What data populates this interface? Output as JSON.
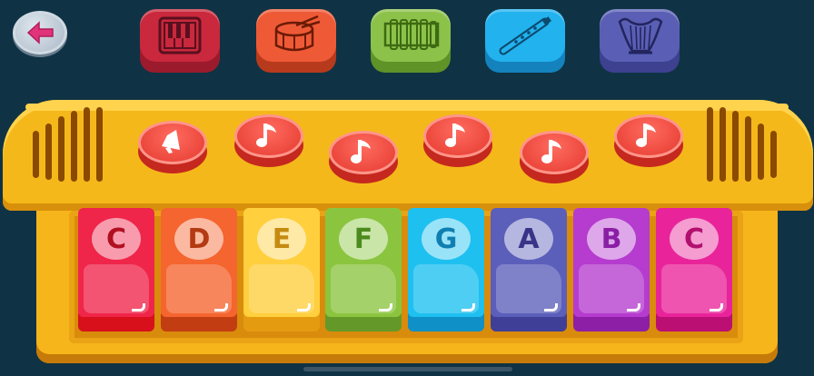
{
  "toolbar": {
    "back": {
      "icon": "back-arrow-icon"
    },
    "instruments": [
      {
        "name": "piano",
        "icon": "piano-icon",
        "face": "#c9283d",
        "base": "#9b1b2d"
      },
      {
        "name": "drum",
        "icon": "drum-icon",
        "face": "#ef5a36",
        "base": "#b83a1d"
      },
      {
        "name": "xylophone",
        "icon": "xylophone-icon",
        "face": "#8cc24a",
        "base": "#5f9227"
      },
      {
        "name": "flute",
        "icon": "flute-icon",
        "face": "#22b2ee",
        "base": "#1482bd"
      },
      {
        "name": "harp",
        "icon": "harp-icon",
        "face": "#5a5fb5",
        "base": "#3d4190"
      }
    ]
  },
  "sound_buttons": [
    {
      "icon": "speaker-icon"
    },
    {
      "icon": "music-note-icon"
    },
    {
      "icon": "music-note-icon"
    },
    {
      "icon": "music-note-icon"
    },
    {
      "icon": "music-note-icon"
    },
    {
      "icon": "music-note-icon"
    }
  ],
  "keys": [
    {
      "label": "C",
      "color": "#f0254a",
      "base": "#d7101c",
      "text": "#b01020"
    },
    {
      "label": "D",
      "color": "#f5652f",
      "base": "#c33d12",
      "text": "#b33a12"
    },
    {
      "label": "E",
      "color": "#ffcf3d",
      "base": "#e49b10",
      "text": "#c58a10"
    },
    {
      "label": "F",
      "color": "#8bc53f",
      "base": "#64992a",
      "text": "#4d8a1e"
    },
    {
      "label": "G",
      "color": "#1ec0f0",
      "base": "#0f90c6",
      "text": "#0f7fb1"
    },
    {
      "label": "A",
      "color": "#5b5fba",
      "base": "#403f97",
      "text": "#3a3488"
    },
    {
      "label": "B",
      "color": "#b53ccf",
      "base": "#8d1fa6",
      "text": "#8a1fa5"
    },
    {
      "label": "C",
      "color": "#e9249a",
      "base": "#bb0f74",
      "text": "#b2106f"
    }
  ]
}
